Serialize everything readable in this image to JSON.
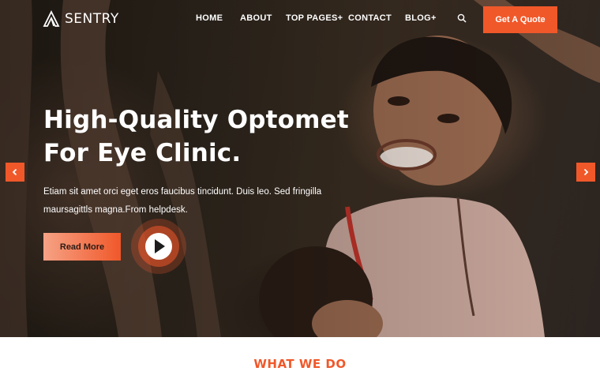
{
  "brand": {
    "name": "SENTRY",
    "accent": "#f0582a"
  },
  "nav": {
    "items": [
      {
        "label": "HOME"
      },
      {
        "label": "ABOUT"
      },
      {
        "label": "TOP PAGES+"
      },
      {
        "label": "CONTACT"
      },
      {
        "label": "BLOG+"
      }
    ],
    "search_icon": "search-icon",
    "cta_label": "Get A Quote"
  },
  "hero": {
    "headline_line1": "High-Quality Optomet",
    "headline_line2": "For Eye Clinic.",
    "description_line1": "Etiam sit amet orci eget eros faucibus tincidunt. Duis leo. Sed fringilla",
    "description_line2": "maursagittls magna.From helpdesk.",
    "read_more_label": "Read More",
    "play_icon": "play-icon",
    "prev_icon": "chevron-left-icon",
    "next_icon": "chevron-right-icon"
  },
  "section": {
    "title": "WHAT WE DO"
  }
}
